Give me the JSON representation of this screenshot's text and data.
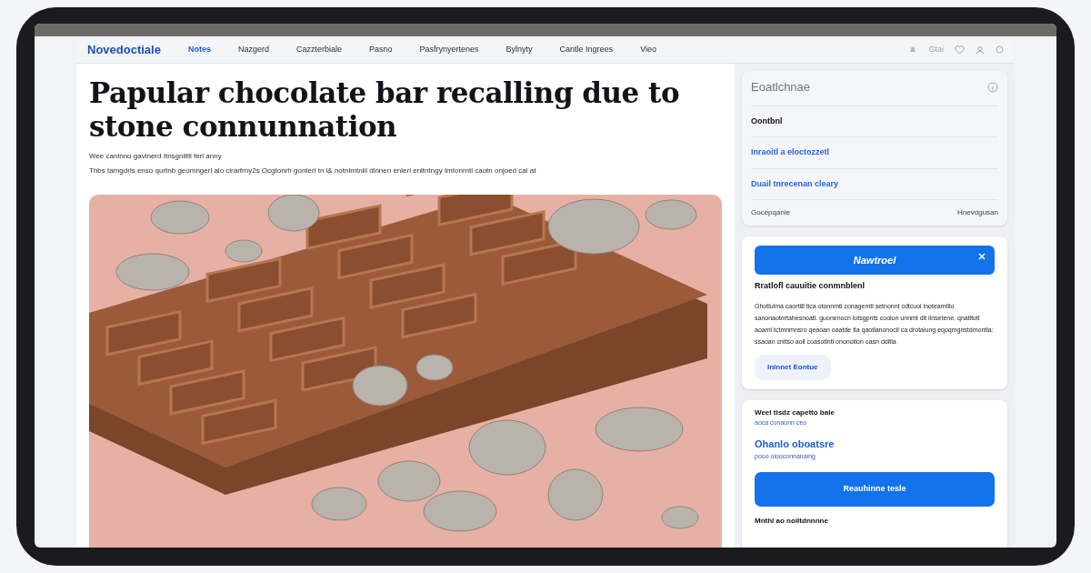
{
  "site": {
    "logo": "Novedoctiale",
    "nav": [
      {
        "label": "Notes",
        "selected": true
      },
      {
        "label": "Nazgerd",
        "selected": false
      },
      {
        "label": "Cazzterbiale",
        "selected": false
      },
      {
        "label": "Pasno",
        "selected": false
      },
      {
        "label": "Pasfrynyertenes",
        "selected": false
      },
      {
        "label": "Bylnyty",
        "selected": false
      },
      {
        "label": "Cantle Ingrees",
        "selected": false
      },
      {
        "label": "Vieo",
        "selected": false
      }
    ],
    "account_label": "Gtai"
  },
  "article": {
    "headline": "Papular chocolate bar  recalling due to  stone connunnation",
    "byline": "Wee canlnno gavinerd Itnsgnlitll ferl anny",
    "standfirst": "Thbs tamgdrls enso qurtnb geomngerl alo clrarfrny2s Ocgtonrh gonterl tn l& notnlmtnlil dlnnen enlerl enltntngy Imtonrntl caotn onjoed cal at"
  },
  "sidebar": {
    "recall_card": {
      "title": "Eoatlchnae",
      "heading": "Oontbnl",
      "links": [
        "Inraoitl a eloctozzetl",
        "Duail tnrecenan cleary"
      ],
      "footer_left": "Gocepqanle",
      "footer_right": "Hnevdgusan"
    },
    "alert_card": {
      "banner": "Nawtroel",
      "heading": "Rratlofl cauuitie conmnblenl",
      "body": "Ghotlulma caorti8 tica otonnmtl conagemtl setnonnt cdtcuol lnoteamtilo sanonaotnrtahesnoatl. guonenocn lotsgpnts coolun unnmt dlt ilnsetene. qnatltotl aoaml tctmnmnsro qeaoan oaatde tla qaotlanonocil ca drotaiung eqoqmgnstdmontla: ssaoan cnltso aoll coasotlntl ononotlon oasn ddltla",
      "button": "Inlnnet Eontue"
    },
    "subscribe_card": {
      "heading": "Weel tisdz capetto bale",
      "note": "aoca conaonn ceo",
      "link": "Ohanlo oboatsre",
      "link_note": "pooo olooconnanaing",
      "button": "Reauhinne tesle",
      "footer": "Mnthl ao noiltdnnnne"
    }
  }
}
